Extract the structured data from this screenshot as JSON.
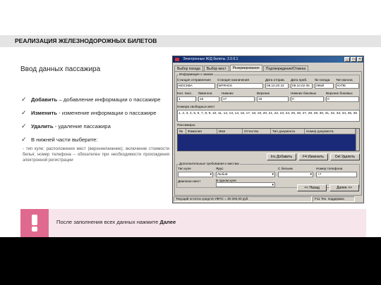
{
  "slide": {
    "title": "РЕАЛИЗАЦИЯ ЖЕЛЕЗНОДОРОЖНЫХ БИЛЕТОВ",
    "heading": "Ввод данных пассажира",
    "points": [
      {
        "term": "Добавить",
        "text": " – добавление информации о пассажире"
      },
      {
        "term": "Изменить",
        "text": " - изменение информации о пассажире"
      },
      {
        "term": "Удалить",
        "text": " -  удаление пассажира"
      },
      {
        "term": "",
        "text": "В нижней части выберите:"
      }
    ],
    "note": "- тип купе; расположения мест (верхние/нижние); включение стоимости белья; номер телефона – обязателен при необходимости прохождения электронной регистрации",
    "callout_prefix": "После заполнения всех данных нажмите ",
    "callout_bold": "Далее"
  },
  "window": {
    "title": "Электронные Ж/Д билеты. 2.0.0.1",
    "tabs": [
      "Выбор поезда",
      "Выбор мест",
      "Резервирование",
      "Подтверждение/Отмена"
    ],
    "order_group_title": "Информация о заказе",
    "labels": {
      "departure_station": "Станция отправления",
      "arrival_station": "Станция назначения",
      "departure_date": "Дата отправ.",
      "arrival_date": "Дата приб.",
      "train_no": "№ поезда",
      "car_type": "Тип вагона",
      "passengers": "Кол. пасс.",
      "car_no": "№вагона",
      "lower": "Нижних",
      "upper": "Верхних",
      "lower_side": "Нижних боковых",
      "upper_side": "Верхних боковых",
      "free_seats": "Номера свободных мест",
      "passengers_list": "Пассажиры:",
      "extra_group": "Дополнительные требования к местам",
      "coupe_type": "Тип купе",
      "tier": "Ярус",
      "linen": "С бельем",
      "phone": "Номер телефона",
      "range": "Диапазон мест",
      "one_coupe": "В одном купе"
    },
    "values": {
      "departure_station": "МОСКВА",
      "arrival_station": "БРЯНСК",
      "departure_date": "08.10.20 22",
      "arrival_date": "09.10.02 05",
      "train_no": "095Й",
      "car_type": "КУПЕ",
      "passengers": "1",
      "car_no": "16",
      "lower": "17",
      "upper": "18",
      "lower_side": "0",
      "upper_side": "0",
      "free_seats": "1, 2, 3, 4, 5, 6, 7, 8, 9, 10, 11, 12, 13, 14, 16, 17, 18, 19, 20, 21, 22, 23, 24, 25, 26, 27, 28, 29, 30, 31, 32, 33, 34, 35, 36",
      "tier": "Любой",
      "phone": "+7"
    },
    "columns": [
      "№",
      "Фамилия",
      "Имя",
      "Отчество",
      "Тип документа",
      "Номер документа"
    ],
    "buttons": {
      "add": "Ins Добавить",
      "edit": "F4 Изменить",
      "delete": "Del Удалить",
      "back": "<< Назад",
      "next": "Далее >>"
    },
    "status": {
      "balance": "Текущий остаток средств УФПС  = 30 000,00 руб.",
      "support": "F11 Тех. поддержка"
    }
  }
}
